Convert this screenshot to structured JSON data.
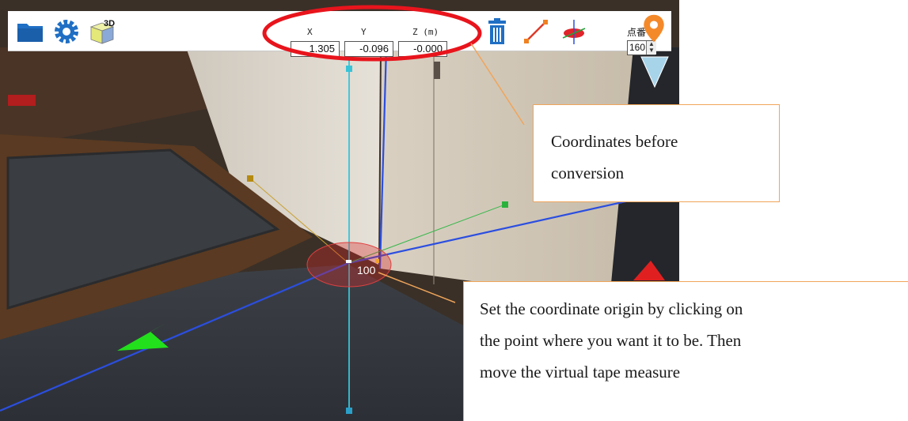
{
  "toolbar": {
    "coords": {
      "x_label": "X",
      "y_label": "Y",
      "z_label": "Z (m)",
      "x_value": "1.305",
      "y_value": "-0.096",
      "z_value": "-0.000"
    },
    "point_number_label": "点番号",
    "point_number_value": "160",
    "threed_label": "3D",
    "icons": [
      "folder-icon",
      "gear-icon",
      "3d-view-icon",
      "trash-icon",
      "line-tool-icon",
      "axis-tool-icon",
      "location-pin-icon"
    ]
  },
  "scene": {
    "origin_label": "100"
  },
  "callouts": {
    "coords_note": [
      "Coordinates before",
      "conversion"
    ],
    "origin_note": [
      "Set the coordinate origin by clicking on",
      "the point where you want it to be. Then",
      "move the virtual tape measure"
    ]
  },
  "colors": {
    "highlight": "#e8141c",
    "callout_border": "#f0a55a",
    "axis_blue": "#2b4ee0",
    "axis_cyan": "#38c3d8",
    "arrow_green": "#22e01b",
    "app_blue": "#1f6fc4"
  }
}
